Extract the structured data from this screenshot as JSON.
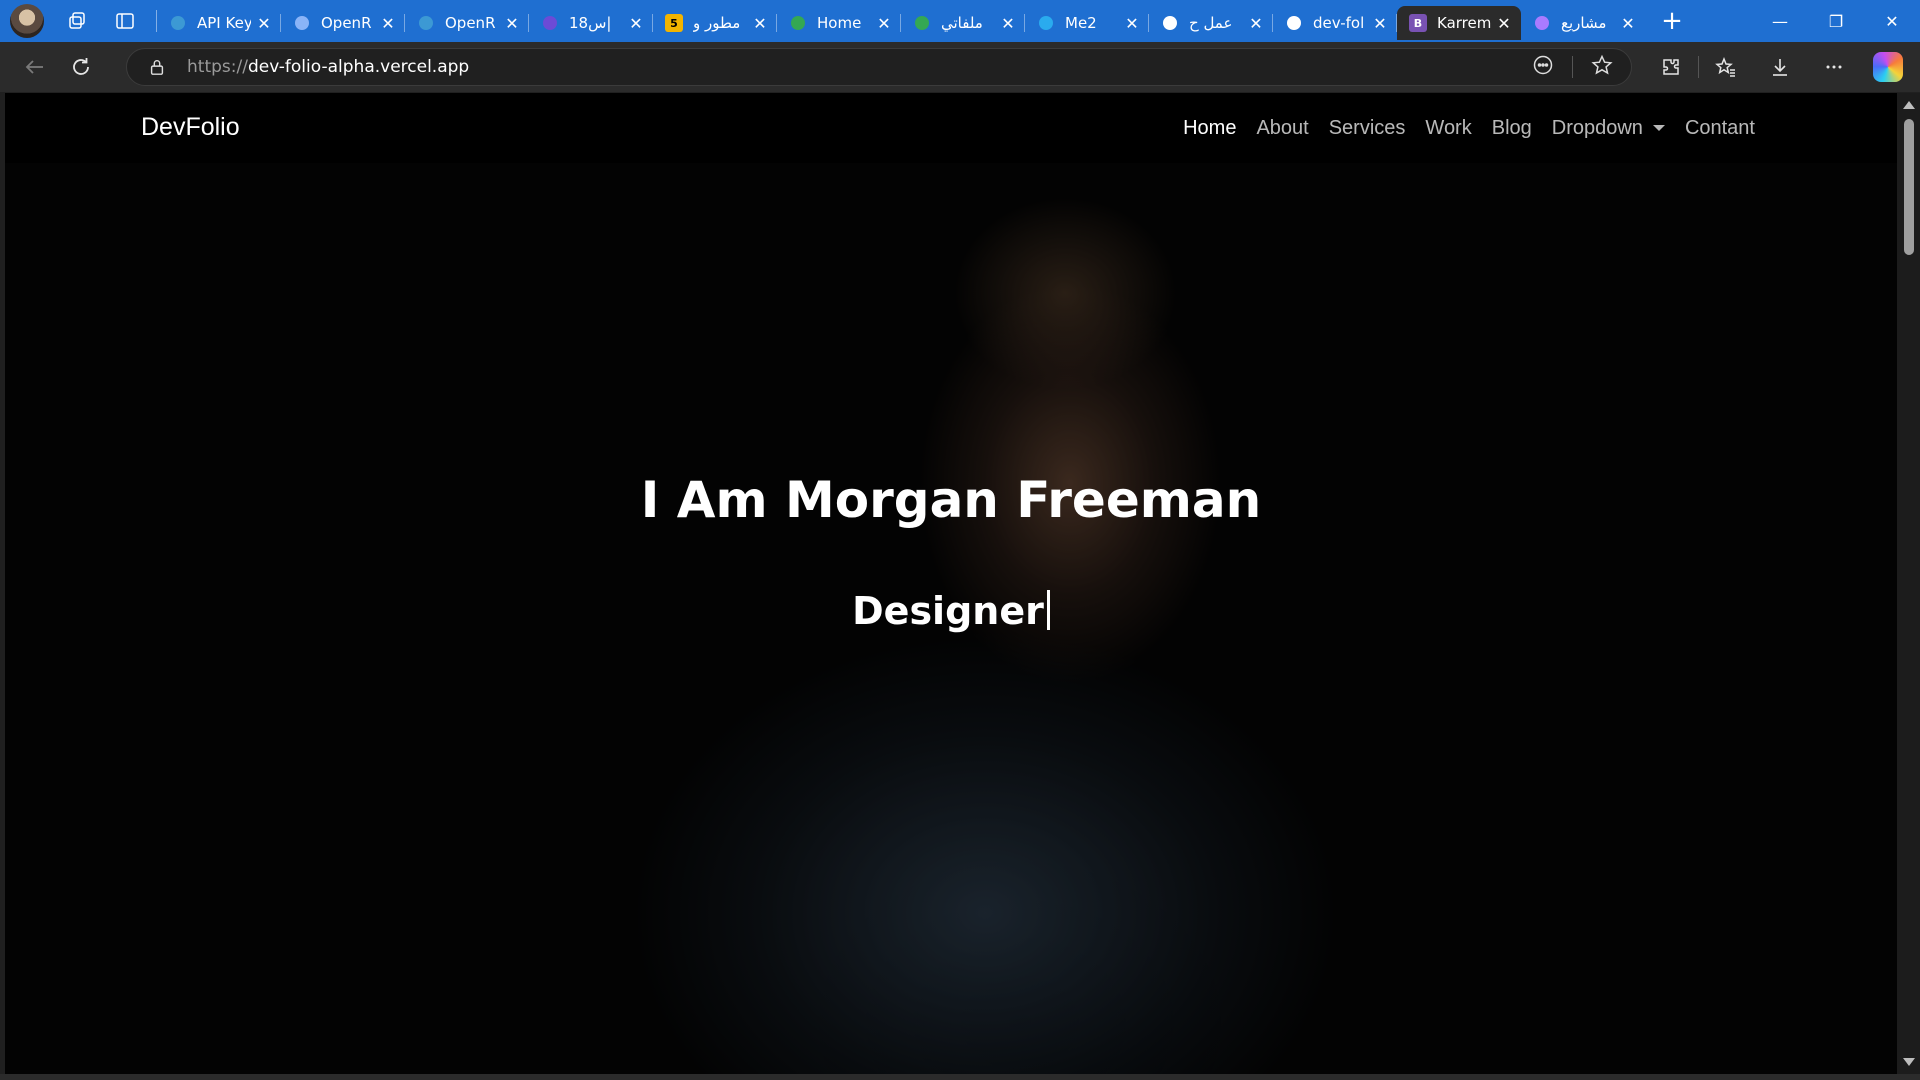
{
  "browser": {
    "tabs": [
      {
        "title": "API Key",
        "favicon": "vscode-icon",
        "favicon_color": "#3c99d4",
        "active": false
      },
      {
        "title": "OpenR",
        "favicon": "openrouter-icon",
        "favicon_color": "#8ab4f8",
        "active": false
      },
      {
        "title": "OpenR",
        "favicon": "vscode-icon",
        "favicon_color": "#3c99d4",
        "active": false
      },
      {
        "title": "س18|",
        "favicon": "video-icon",
        "favicon_color": "#6c4bd6",
        "active": false
      },
      {
        "title": "مطور و",
        "favicon": "number-badge-icon",
        "favicon_color": "#f2b400",
        "favicon_text": "5",
        "active": false
      },
      {
        "title": "Home",
        "favicon": "google-drive-icon",
        "favicon_color": "#34a853",
        "active": false
      },
      {
        "title": "ملفاتي",
        "favicon": "google-drive-icon",
        "favicon_color": "#34a853",
        "active": false
      },
      {
        "title": "Me2",
        "favicon": "telegram-icon",
        "favicon_color": "#2aabee",
        "active": false
      },
      {
        "title": "عمل ح",
        "favicon": "chatgpt-icon",
        "favicon_color": "#ffffff",
        "active": false
      },
      {
        "title": "dev-fol",
        "favicon": "vercel-icon",
        "favicon_color": "#ffffff",
        "active": false
      },
      {
        "title": "Karrem",
        "favicon": "bootstrap-icon",
        "favicon_color": "#7952b3",
        "favicon_text": "B",
        "active": true
      },
      {
        "title": "مشاريع",
        "favicon": "star-app-icon",
        "favicon_color": "#a97bff",
        "active": false
      }
    ],
    "address": {
      "scheme": "https://",
      "host": "dev-folio-alpha.vercel.app"
    },
    "colors": {
      "tabstrip": "#1f6fd1",
      "toolbar": "#2b2b2b"
    }
  },
  "site": {
    "brand": "DevFolio",
    "nav": [
      {
        "label": "Home",
        "active": true,
        "dropdown": false
      },
      {
        "label": "About",
        "active": false,
        "dropdown": false
      },
      {
        "label": "Services",
        "active": false,
        "dropdown": false
      },
      {
        "label": "Work",
        "active": false,
        "dropdown": false
      },
      {
        "label": "Blog",
        "active": false,
        "dropdown": false
      },
      {
        "label": "Dropdown",
        "active": false,
        "dropdown": true
      },
      {
        "label": "Contant",
        "active": false,
        "dropdown": false
      }
    ],
    "hero": {
      "title": "I Am Morgan Freeman",
      "typed_text": "Designer"
    }
  }
}
